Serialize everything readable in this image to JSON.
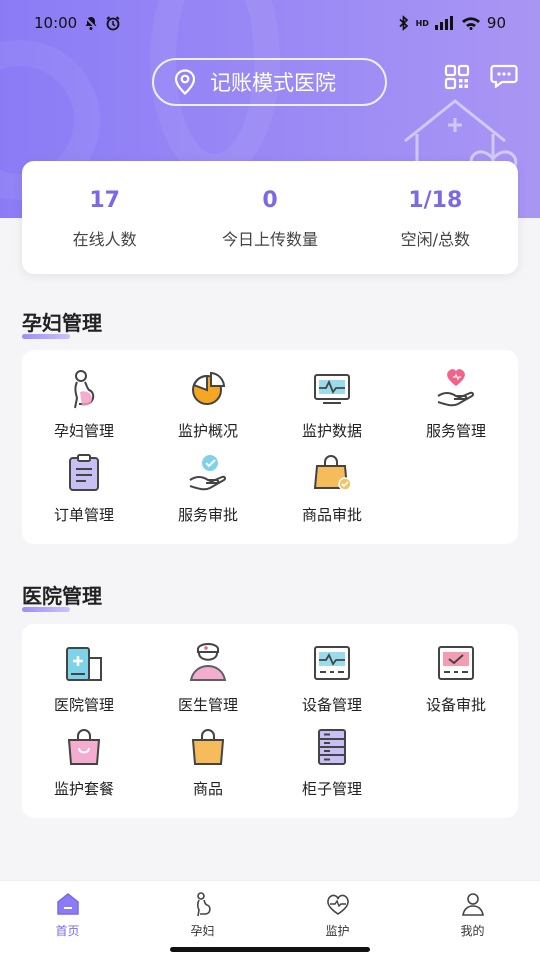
{
  "status_bar": {
    "time": "10:00",
    "battery": "90",
    "network_tag": "HD"
  },
  "header": {
    "hospital_name": "记账模式医院"
  },
  "stats": [
    {
      "value": "17",
      "label": "在线人数"
    },
    {
      "value": "0",
      "label": "今日上传数量"
    },
    {
      "value": "1/18",
      "label": "空闲/总数"
    }
  ],
  "sections": {
    "maternal": {
      "title": "孕妇管理",
      "items": [
        {
          "label": "孕妇管理",
          "icon": "pregnant-woman-icon"
        },
        {
          "label": "监护概况",
          "icon": "pie-chart-icon"
        },
        {
          "label": "监护数据",
          "icon": "monitor-data-icon"
        },
        {
          "label": "服务管理",
          "icon": "hand-heart-icon"
        },
        {
          "label": "订单管理",
          "icon": "order-list-icon"
        },
        {
          "label": "服务审批",
          "icon": "hand-check-icon"
        },
        {
          "label": "商品审批",
          "icon": "bag-check-icon"
        }
      ]
    },
    "hospital": {
      "title": "医院管理",
      "items": [
        {
          "label": "医院管理",
          "icon": "hospital-building-icon"
        },
        {
          "label": "医生管理",
          "icon": "doctor-icon"
        },
        {
          "label": "设备管理",
          "icon": "device-monitor-icon"
        },
        {
          "label": "设备审批",
          "icon": "device-check-icon"
        },
        {
          "label": "监护套餐",
          "icon": "gift-bag-icon"
        },
        {
          "label": "商品",
          "icon": "shopping-bag-icon"
        },
        {
          "label": "柜子管理",
          "icon": "cabinet-icon"
        }
      ]
    }
  },
  "tabs": [
    {
      "label": "首页",
      "icon": "home-icon",
      "active": true
    },
    {
      "label": "孕妇",
      "icon": "pregnant-icon",
      "active": false
    },
    {
      "label": "监护",
      "icon": "heartbeat-icon",
      "active": false
    },
    {
      "label": "我的",
      "icon": "user-icon",
      "active": false
    }
  ],
  "colors": {
    "accent": "#7b6ae6",
    "header_start": "#8b7cf6",
    "header_end": "#a996f3"
  }
}
